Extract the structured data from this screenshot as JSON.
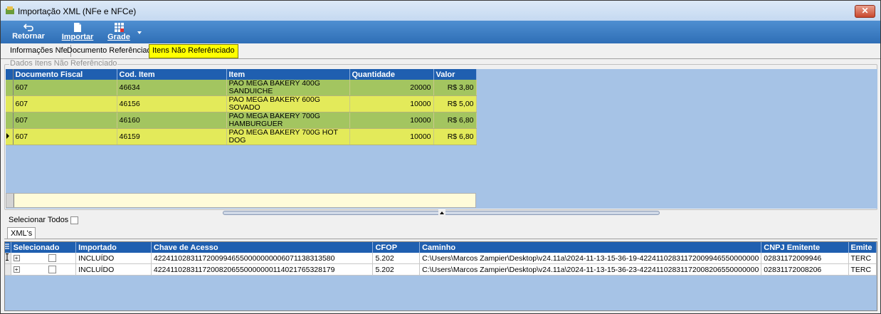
{
  "window": {
    "title": "Importação XML (NFe e NFCe)",
    "close_label": "✕"
  },
  "toolbar": {
    "retornar_label": "Retornar",
    "importar_label": "Importar",
    "grade_label": "Grade"
  },
  "tabs": [
    {
      "label": "Informações Nfe"
    },
    {
      "label": "Documento Referênciado"
    },
    {
      "label": "Itens Não Referênciado"
    }
  ],
  "itens": {
    "group_caption": "Dados Itens Não Referênciado",
    "columns": [
      "Documento Fiscal",
      "Cod. Item",
      "Item",
      "Quantidade",
      "Valor"
    ],
    "rows": [
      {
        "doc": "607",
        "cod": "46634",
        "item": "PAO MEGA BAKERY 400G SANDUICHE",
        "qtd": "20000",
        "valor": "R$ 3,80"
      },
      {
        "doc": "607",
        "cod": "46156",
        "item": "PAO MEGA BAKERY 600G SOVADO",
        "qtd": "10000",
        "valor": "R$ 5,00"
      },
      {
        "doc": "607",
        "cod": "46160",
        "item": "PAO MEGA BAKERY 700G HAMBURGUER",
        "qtd": "10000",
        "valor": "R$ 6,80"
      },
      {
        "doc": "607",
        "cod": "46159",
        "item": "PAO MEGA BAKERY 700G HOT DOG",
        "qtd": "10000",
        "valor": "R$ 6,80"
      }
    ]
  },
  "selecionar_todos_label": "Selecionar Todos",
  "xml_tab_label": "XML's",
  "xmls": {
    "columns": [
      "Selecionado",
      "Importado",
      "Chave de Acesso",
      "CFOP",
      "Caminho",
      "CNPJ Emitente",
      "Emite"
    ],
    "rows": [
      {
        "importado": "INCLUÍDO",
        "chave": "42241102831172009946550000000006071138313580",
        "cfop": "5.202",
        "caminho": "C:\\Users\\Marcos Zampier\\Desktop\\v24.11a\\2024-11-13-15-36-19-42241102831172009946550000000",
        "cnpj": "02831172009946",
        "emit": "TERC"
      },
      {
        "importado": "INCLUÍDO",
        "chave": "42241102831172008206550000000114021765328179",
        "cfop": "5.202",
        "caminho": "C:\\Users\\Marcos Zampier\\Desktop\\v24.11a\\2024-11-13-15-36-23-42241102831172008206550000000",
        "cnpj": "02831172008206",
        "emit": "TERC"
      }
    ]
  }
}
